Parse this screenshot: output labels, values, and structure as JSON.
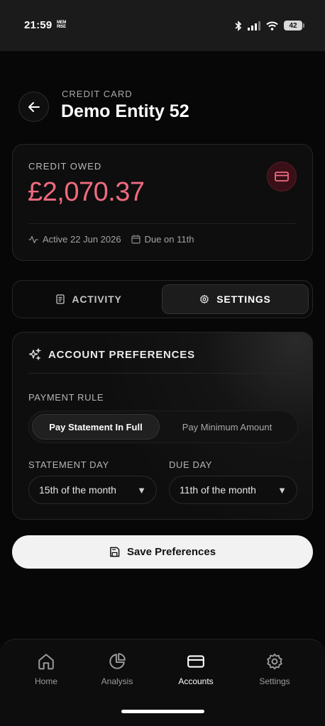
{
  "status_bar": {
    "time": "21:59",
    "logo_text": "MEM RISE",
    "battery": "42"
  },
  "header": {
    "subtitle": "CREDIT CARD",
    "title": "Demo Entity 52"
  },
  "balance": {
    "label": "CREDIT OWED",
    "amount": "£2,070.37",
    "amount_color": "#ef6b7f",
    "active_text": "Active 22 Jun 2026",
    "due_text": "Due on 11th"
  },
  "tabs": [
    {
      "label": "ACTIVITY",
      "active": false
    },
    {
      "label": "SETTINGS",
      "active": true
    }
  ],
  "preferences": {
    "title": "ACCOUNT PREFERENCES",
    "payment_rule_label": "PAYMENT RULE",
    "payment_options": [
      "Pay Statement In Full",
      "Pay Minimum Amount"
    ],
    "payment_selected": "Pay Statement In Full",
    "statement_day_label": "STATEMENT DAY",
    "statement_day_value": "15th of the month",
    "due_day_label": "DUE DAY",
    "due_day_value": "11th of the month"
  },
  "save_button": {
    "label": "Save Preferences"
  },
  "bottom_nav": [
    {
      "label": "Home",
      "icon": "home-icon",
      "active": false
    },
    {
      "label": "Analysis",
      "icon": "pie-chart-icon",
      "active": false
    },
    {
      "label": "Accounts",
      "icon": "credit-card-icon",
      "active": true
    },
    {
      "label": "Settings",
      "icon": "gear-icon",
      "active": false
    }
  ]
}
